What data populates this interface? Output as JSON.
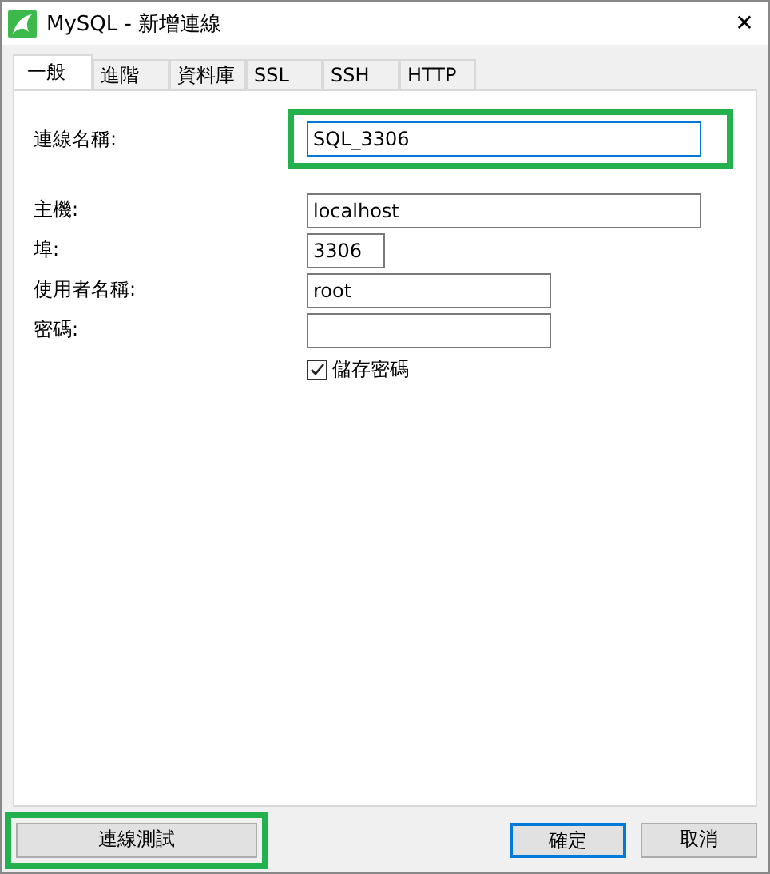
{
  "window": {
    "title": "MySQL - 新增連線",
    "close": "✕"
  },
  "tabs": [
    {
      "label": "一般",
      "selected": true
    },
    {
      "label": "進階",
      "selected": false
    },
    {
      "label": "資料庫",
      "selected": false
    },
    {
      "label": "SSL",
      "selected": false
    },
    {
      "label": "SSH",
      "selected": false
    },
    {
      "label": "HTTP",
      "selected": false
    }
  ],
  "connection_name": {
    "label": "連線名稱:",
    "value": "SQL_3306",
    "focused": true,
    "highlighted": true
  },
  "fields": [
    {
      "label": "主機:",
      "value": "localhost",
      "kind": "long"
    },
    {
      "label": "埠:",
      "value": "3306",
      "kind": "short"
    },
    {
      "label": "使用者名稱:",
      "value": "root",
      "kind": "medium"
    },
    {
      "label": "密碼:",
      "kind": "medium"
    }
  ],
  "save_password": {
    "label": "儲存密碼",
    "checked": true
  },
  "buttons": [
    {
      "label": "連線測試",
      "kind": "left",
      "highlighted": true,
      "default": false
    },
    {
      "label": "確定",
      "kind": "right",
      "highlighted": false,
      "default": true
    },
    {
      "label": "取消",
      "kind": "right",
      "highlighted": false,
      "default": false
    }
  ]
}
